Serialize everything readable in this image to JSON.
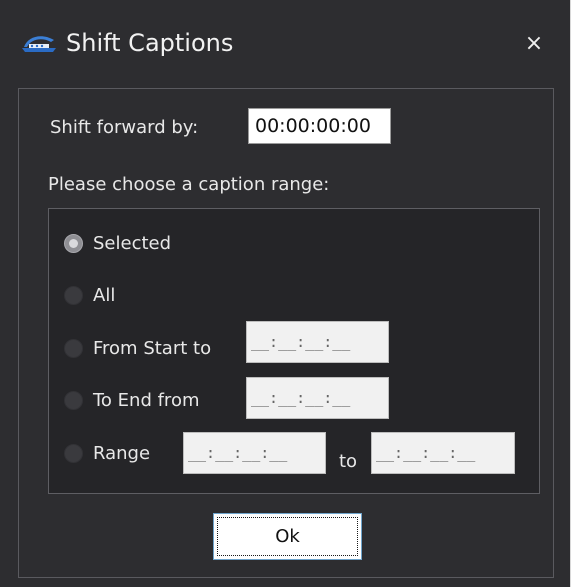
{
  "window": {
    "title": "Shift Captions",
    "close_glyph": "×",
    "icon": "app-logo-icon"
  },
  "shift": {
    "label": "Shift forward by:",
    "value": "00:00:00:00"
  },
  "range": {
    "prompt": "Please choose a caption range:",
    "selected_option": "Selected",
    "options": [
      {
        "label": "Selected",
        "checked": true
      },
      {
        "label": "All",
        "checked": false
      },
      {
        "label": "From Start to",
        "checked": false,
        "value": "__:__:__:__"
      },
      {
        "label": "To End from",
        "checked": false,
        "value": "__:__:__:__"
      },
      {
        "label": "Range",
        "checked": false,
        "from": "__:__:__:__",
        "to": "__:__:__:__",
        "to_label": "to"
      }
    ]
  },
  "actions": {
    "ok_label": "Ok"
  },
  "colors": {
    "background": "#2d2d30",
    "accent_focus": "#6ea4cc"
  }
}
